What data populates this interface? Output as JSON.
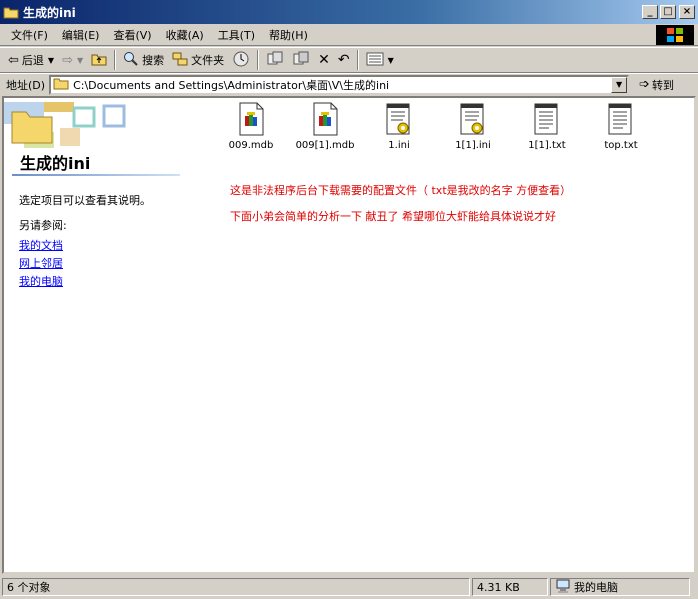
{
  "window": {
    "title": "生成的ini"
  },
  "menu": [
    {
      "label": "文件(F)"
    },
    {
      "label": "编辑(E)"
    },
    {
      "label": "查看(V)"
    },
    {
      "label": "收藏(A)"
    },
    {
      "label": "工具(T)"
    },
    {
      "label": "帮助(H)"
    }
  ],
  "toolbar": {
    "back": "后退",
    "search": "搜索",
    "folders": "文件夹"
  },
  "address": {
    "label": "地址(D)",
    "path": "C:\\Documents and Settings\\Administrator\\桌面\\V\\生成的ini",
    "go": "转到"
  },
  "left_panel": {
    "title": "生成的ini",
    "desc": "选定项目可以查看其说明。",
    "see_also": "另请参阅:",
    "links": [
      "我的文档",
      "网上邻居",
      "我的电脑"
    ]
  },
  "files": [
    {
      "name": "009.mdb",
      "icon": "mdb-icon"
    },
    {
      "name": "009[1].mdb",
      "icon": "mdb-icon"
    },
    {
      "name": "1.ini",
      "icon": "ini-icon"
    },
    {
      "name": "1[1].ini",
      "icon": "ini-icon"
    },
    {
      "name": "1[1].txt",
      "icon": "txt-icon"
    },
    {
      "name": "top.txt",
      "icon": "txt-icon"
    }
  ],
  "notes": [
    "这是非法程序后台下载需要的配置文件（ txt是我改的名字 方便查看）",
    "下面小弟会简单的分析一下  献丑了  希望哪位大虾能给具体说说才好"
  ],
  "status": {
    "objects": "6 个对象",
    "size": "4.31 KB",
    "location": "我的电脑"
  },
  "colors": {
    "title_start": "#0a246a",
    "note": "#e00000",
    "link": "#0000ff"
  }
}
